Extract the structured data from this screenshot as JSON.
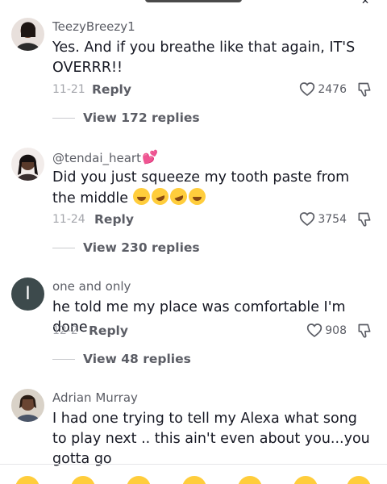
{
  "comments": [
    {
      "username": "TeezyBreezy1",
      "text": "Yes. And if you breathe like that again, IT'S OVERRR!!",
      "date": "11-21",
      "reply_label": "Reply",
      "likes": "2476",
      "view_replies": "View 172 replies"
    },
    {
      "username": "@tendai_heart",
      "text": "Did you just squeeze my tooth paste from the middle",
      "date": "11-24",
      "reply_label": "Reply",
      "likes": "3754",
      "view_replies": "View 230 replies"
    },
    {
      "username": "one and only",
      "avatar_letter": "I",
      "text": "he told me my place was comfortable I'm done",
      "date": "12-2",
      "reply_label": "Reply",
      "likes": "908",
      "view_replies": "View 48 replies"
    },
    {
      "username": "Adrian Murray",
      "text": "I had one trying to tell my Alexa what song to play next .. this ain't even about you...you gotta go"
    }
  ],
  "colors": {
    "primary_text": "#161823",
    "secondary_text": "#5b5d65",
    "muted_text": "#a3a5ab",
    "emoji_yellow": "#ffcd3c"
  }
}
